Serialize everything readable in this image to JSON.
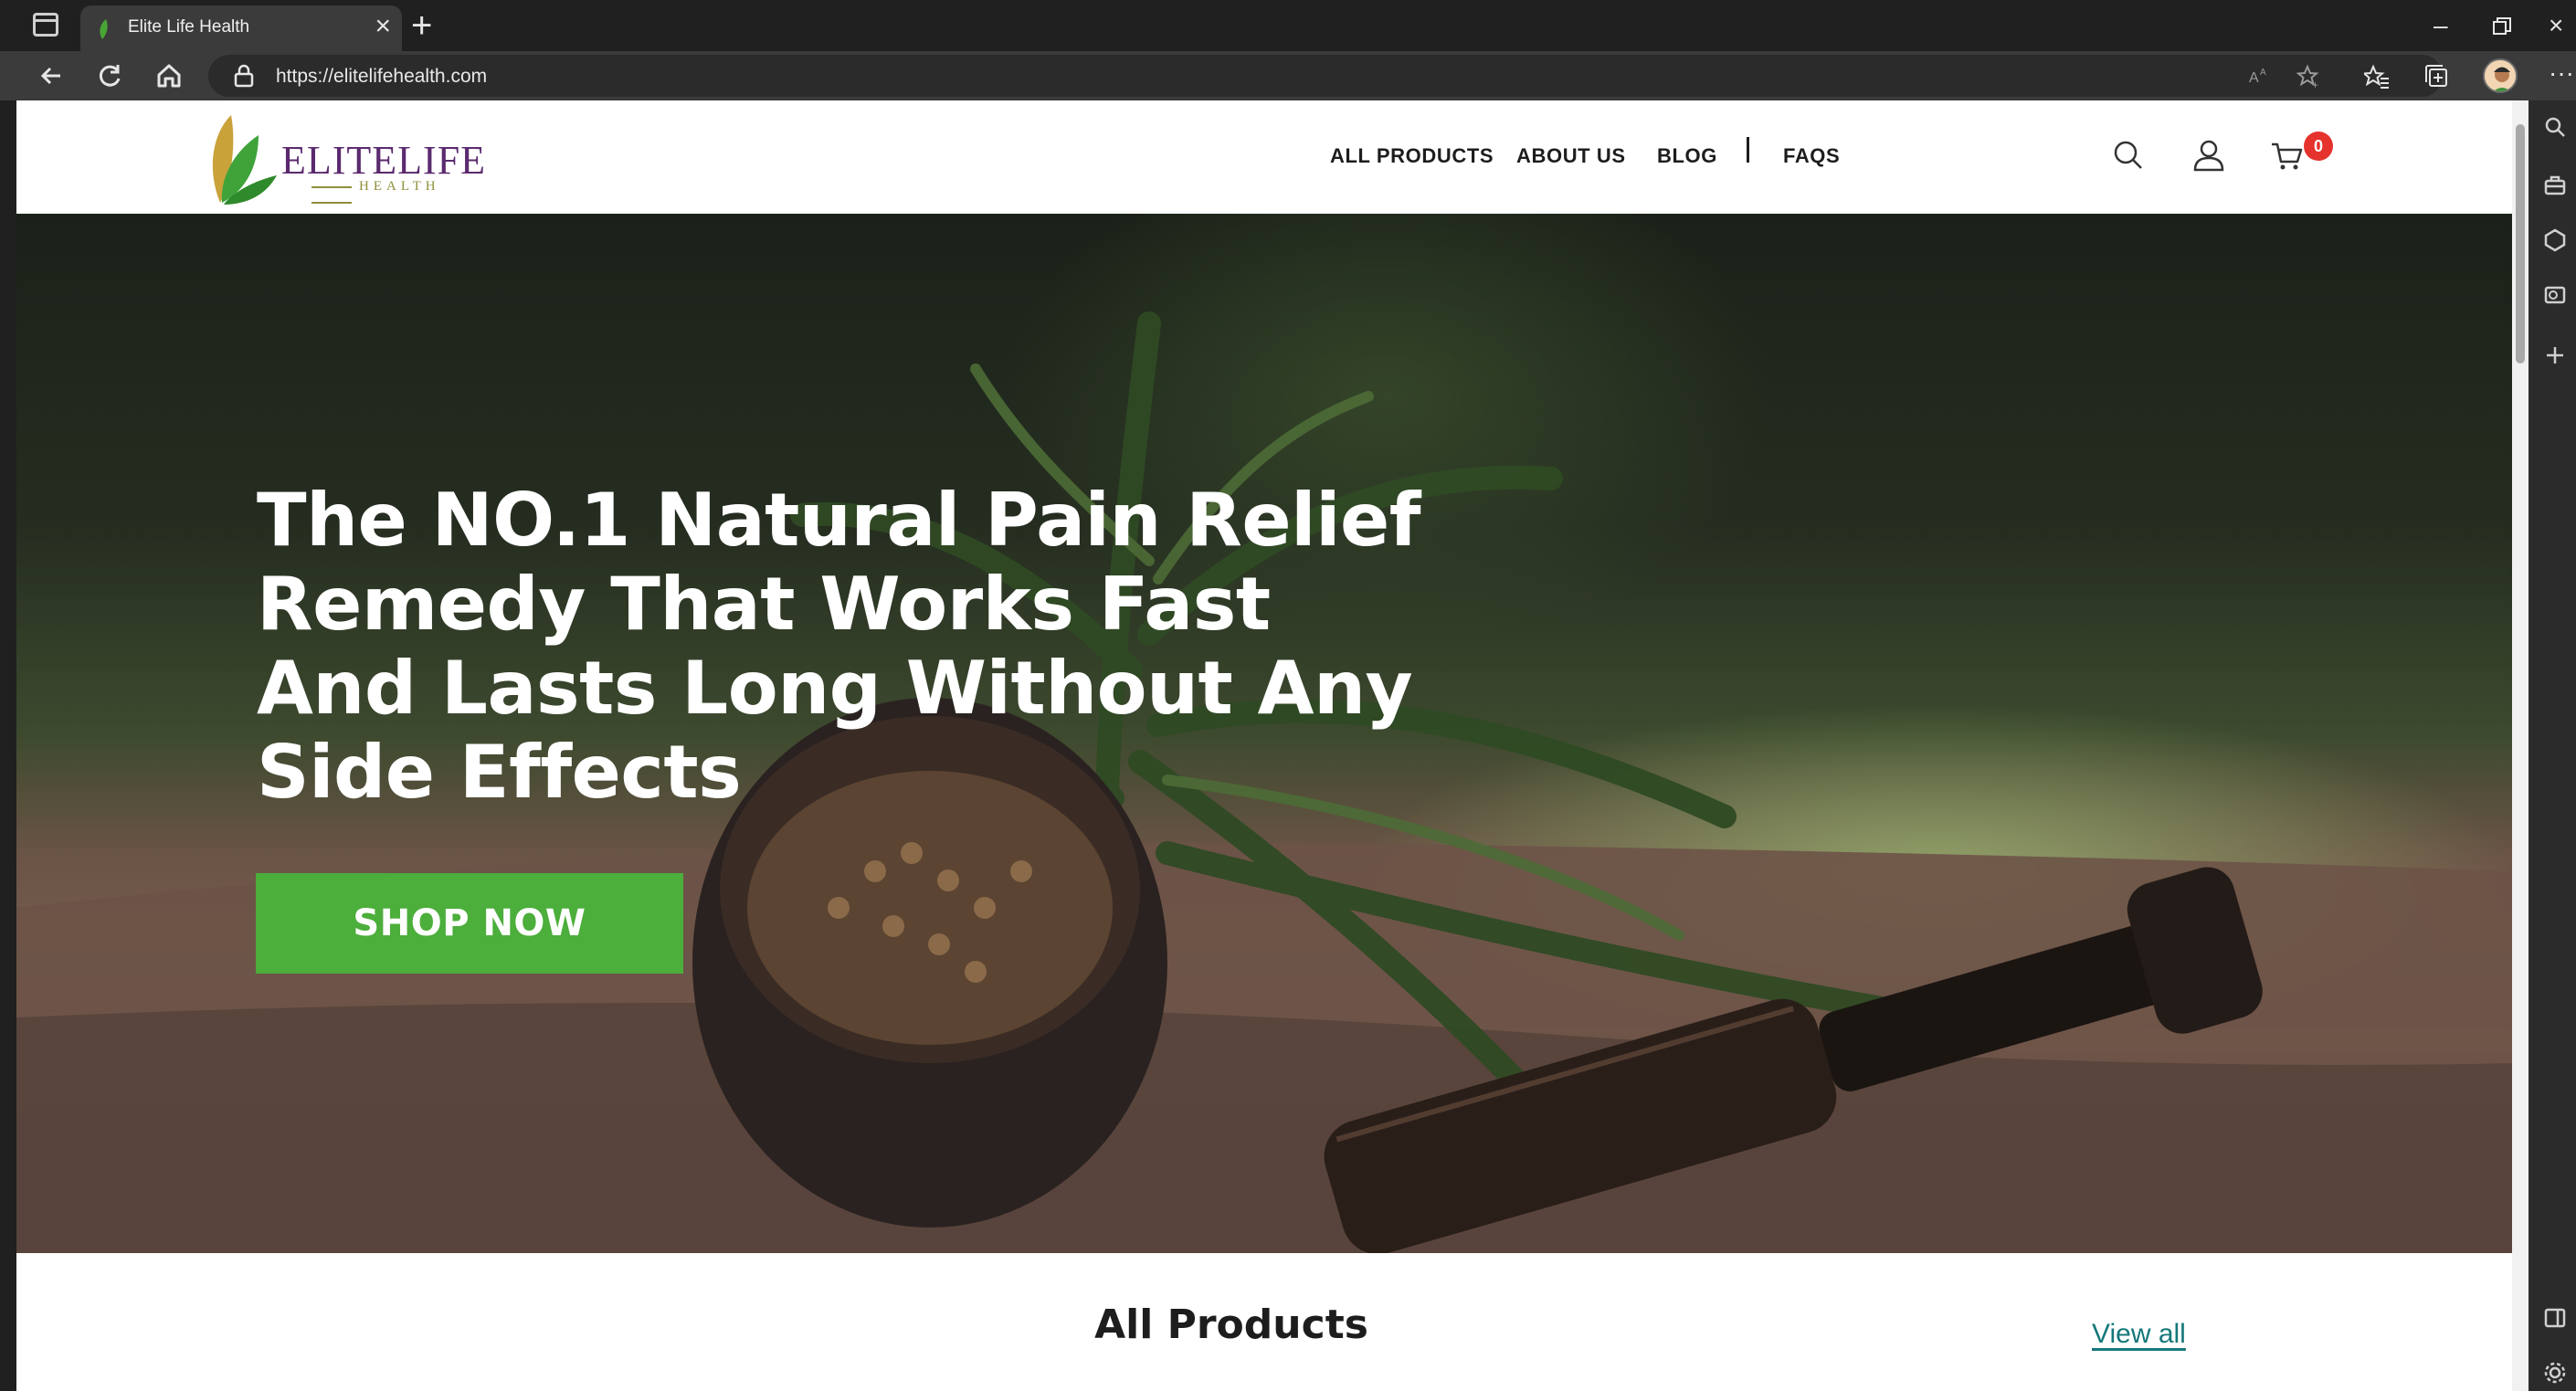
{
  "browser": {
    "tab_title": "Elite Life Health",
    "url": "https://elitelifehealth.com"
  },
  "site": {
    "logo_text": "ELITELIFE",
    "logo_sub": "HEALTH",
    "nav": {
      "all_products": "ALL PRODUCTS",
      "about_us": "ABOUT US",
      "blog": "BLOG",
      "faqs": "FAQS"
    },
    "cart_count": "0",
    "icons": [
      "search-icon",
      "account-icon",
      "cart-icon"
    ]
  },
  "hero": {
    "title": "The NO.1 Natural Pain Relief Remedy That Works Fast And Lasts Long Without Any Side Effects",
    "cta_label": "SHOP NOW"
  },
  "products": {
    "section_title": "All Products",
    "view_all": "View all"
  },
  "colors": {
    "accent_green": "#4cae3b",
    "badge_red": "#e5322d",
    "link_teal": "#15787a",
    "logo_purple": "#5b2a6e"
  }
}
